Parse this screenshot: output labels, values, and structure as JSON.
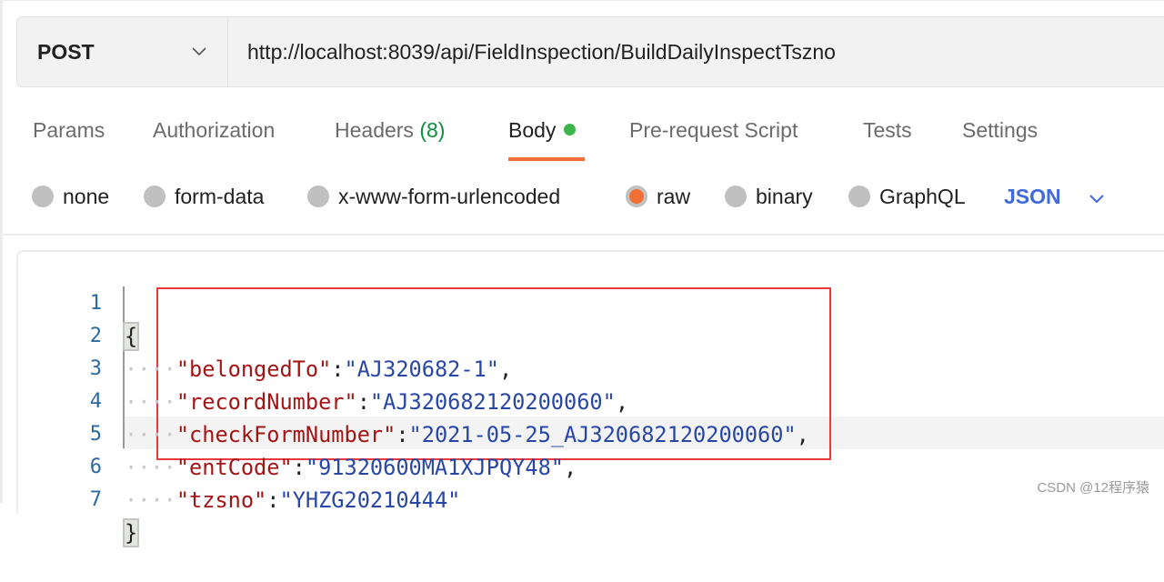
{
  "request": {
    "method": "POST",
    "url": "http://localhost:8039/api/FieldInspection/BuildDailyInspectTszno"
  },
  "tabs": [
    {
      "label": "Params"
    },
    {
      "label": "Authorization"
    },
    {
      "label": "Headers",
      "count": "(8)"
    },
    {
      "label": "Body",
      "active": true,
      "indicator_color": "#3cb64a"
    },
    {
      "label": "Pre-request Script"
    },
    {
      "label": "Tests"
    },
    {
      "label": "Settings"
    }
  ],
  "body_types": [
    {
      "label": "none"
    },
    {
      "label": "form-data"
    },
    {
      "label": "x-www-form-urlencoded"
    },
    {
      "label": "raw",
      "selected": true
    },
    {
      "label": "binary"
    },
    {
      "label": "GraphQL"
    }
  ],
  "format_select": {
    "value": "JSON"
  },
  "editor": {
    "lines": [
      {
        "n": "1",
        "open": "{"
      },
      {
        "n": "2",
        "key": "\"belongedTo\"",
        "value": "\"AJ320682-1\"",
        "comma": ","
      },
      {
        "n": "3",
        "key": "\"recordNumber\"",
        "value": "\"AJ320682120200060\"",
        "comma": ","
      },
      {
        "n": "4",
        "key": "\"checkFormNumber\"",
        "value": "\"2021-05-25_AJ320682120200060\"",
        "comma": ","
      },
      {
        "n": "5",
        "key": "\"entCode\"",
        "value": "\"91320600MA1XJPQY48\"",
        "comma": ","
      },
      {
        "n": "6",
        "key": "\"tzsno\"",
        "value": "\"YHZG20210444\""
      },
      {
        "n": "7",
        "close": "}"
      }
    ]
  },
  "colors": {
    "accent": "#f26b3a",
    "json_select": "#3f6ad8",
    "highlight_box": "#e8393d"
  },
  "watermark": "CSDN @12程序猿"
}
